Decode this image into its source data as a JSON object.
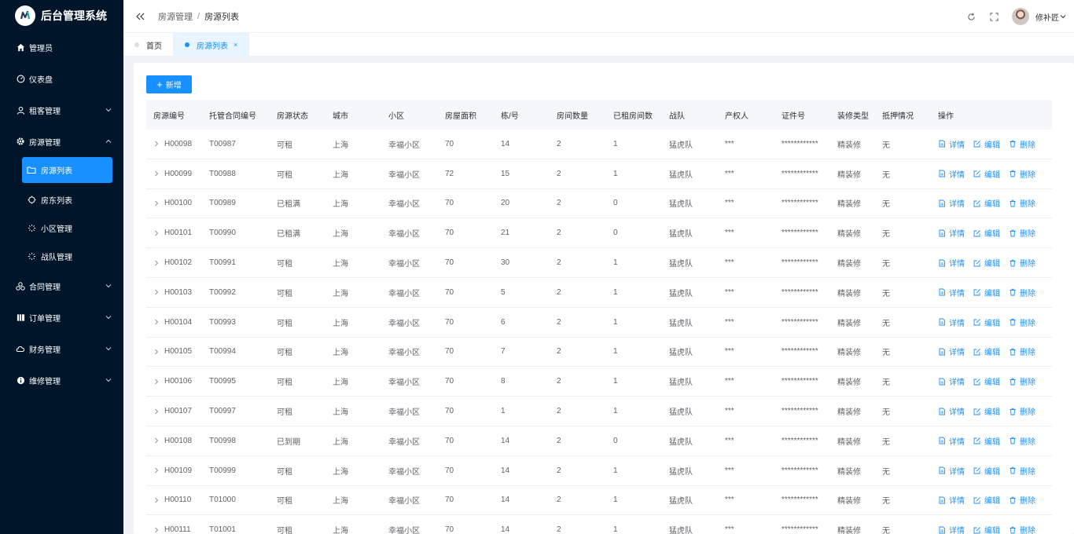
{
  "app": {
    "title": "后台管理系统"
  },
  "sidebar": {
    "items": [
      {
        "label": "管理员",
        "icon": "home-icon"
      },
      {
        "label": "仪表盘",
        "icon": "dashboard-icon"
      },
      {
        "label": "租客管理",
        "icon": "user-icon",
        "expandable": true
      },
      {
        "label": "房源管理",
        "icon": "gear-icon",
        "expandable": true,
        "expanded": true
      },
      {
        "label": "合同管理",
        "icon": "contract-icon",
        "expandable": true
      },
      {
        "label": "订单管理",
        "icon": "order-icon",
        "expandable": true
      },
      {
        "label": "财务管理",
        "icon": "cloud-icon",
        "expandable": true
      },
      {
        "label": "维修管理",
        "icon": "info-icon",
        "expandable": true
      }
    ],
    "sub_items": [
      {
        "label": "房源列表",
        "icon": "folder-icon",
        "active": true
      },
      {
        "label": "房东列表",
        "icon": "circle-icon"
      },
      {
        "label": "小区管理",
        "icon": "sun-icon"
      },
      {
        "label": "战队管理",
        "icon": "sun-icon"
      }
    ]
  },
  "header": {
    "breadcrumb": [
      "房源管理",
      "房源列表"
    ],
    "user_name": "修补匠"
  },
  "tabs": [
    {
      "label": "首页",
      "active": false
    },
    {
      "label": "房源列表",
      "active": true,
      "close": "×"
    }
  ],
  "toolbar": {
    "add_label": "新增",
    "add_symbol": "+"
  },
  "table": {
    "columns": [
      "房源编号",
      "托管合同编号",
      "房源状态",
      "城市",
      "小区",
      "房屋面积",
      "栋/号",
      "房间数量",
      "已租房间数",
      "战队",
      "产权人",
      "证件号",
      "装修类型",
      "抵押情况",
      "操作"
    ],
    "actions": [
      "详情",
      "编辑",
      "删除"
    ],
    "rows": [
      [
        "H00098",
        "T00987",
        "可租",
        "上海",
        "幸福小区",
        "70",
        "14",
        "2",
        "1",
        "猛虎队",
        "***",
        "************",
        "精装修",
        "无"
      ],
      [
        "H00099",
        "T00988",
        "可租",
        "上海",
        "幸福小区",
        "72",
        "15",
        "2",
        "1",
        "猛虎队",
        "***",
        "************",
        "精装修",
        "无"
      ],
      [
        "H00100",
        "T00989",
        "已租满",
        "上海",
        "幸福小区",
        "70",
        "20",
        "2",
        "0",
        "猛虎队",
        "***",
        "************",
        "精装修",
        "无"
      ],
      [
        "H00101",
        "T00990",
        "已租满",
        "上海",
        "幸福小区",
        "70",
        "21",
        "2",
        "0",
        "猛虎队",
        "***",
        "************",
        "精装修",
        "无"
      ],
      [
        "H00102",
        "T00991",
        "可租",
        "上海",
        "幸福小区",
        "70",
        "30",
        "2",
        "1",
        "猛虎队",
        "***",
        "************",
        "精装修",
        "无"
      ],
      [
        "H00103",
        "T00992",
        "可租",
        "上海",
        "幸福小区",
        "70",
        "5",
        "2",
        "1",
        "猛虎队",
        "***",
        "************",
        "精装修",
        "无"
      ],
      [
        "H00104",
        "T00993",
        "可租",
        "上海",
        "幸福小区",
        "70",
        "6",
        "2",
        "1",
        "猛虎队",
        "***",
        "************",
        "精装修",
        "无"
      ],
      [
        "H00105",
        "T00994",
        "可租",
        "上海",
        "幸福小区",
        "70",
        "7",
        "2",
        "1",
        "猛虎队",
        "***",
        "************",
        "精装修",
        "无"
      ],
      [
        "H00106",
        "T00995",
        "可租",
        "上海",
        "幸福小区",
        "70",
        "8",
        "2",
        "1",
        "猛虎队",
        "***",
        "************",
        "精装修",
        "无"
      ],
      [
        "H00107",
        "T00997",
        "可租",
        "上海",
        "幸福小区",
        "70",
        "1",
        "2",
        "1",
        "猛虎队",
        "***",
        "************",
        "精装修",
        "无"
      ],
      [
        "H00108",
        "T00998",
        "已到期",
        "上海",
        "幸福小区",
        "70",
        "14",
        "2",
        "0",
        "猛虎队",
        "***",
        "************",
        "精装修",
        "无"
      ],
      [
        "H00109",
        "T00999",
        "可租",
        "上海",
        "幸福小区",
        "70",
        "14",
        "2",
        "1",
        "猛虎队",
        "***",
        "************",
        "精装修",
        "无"
      ],
      [
        "H00110",
        "T01000",
        "可租",
        "上海",
        "幸福小区",
        "70",
        "14",
        "2",
        "1",
        "猛虎队",
        "***",
        "************",
        "精装修",
        "无"
      ],
      [
        "H00111",
        "T01001",
        "可租",
        "上海",
        "幸福小区",
        "70",
        "14",
        "2",
        "1",
        "猛虎队",
        "***",
        "************",
        "精装修",
        "无"
      ]
    ]
  },
  "colors": {
    "primary": "#1890ff",
    "sidebar_bg": "#001529"
  }
}
